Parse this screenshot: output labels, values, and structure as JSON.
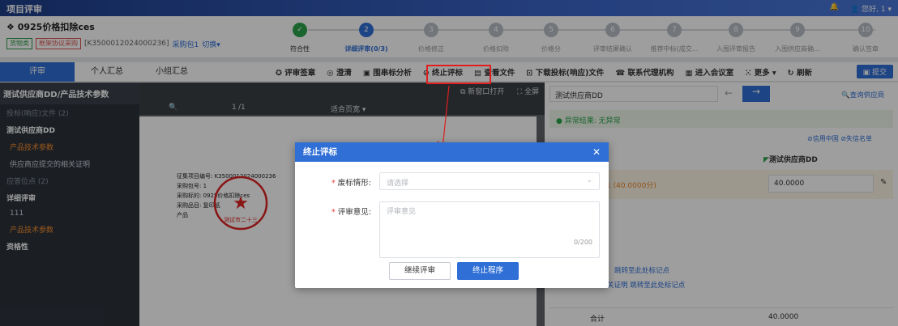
{
  "app": {
    "title": "项目评审",
    "greeting": "您好, 1"
  },
  "project": {
    "name": "0925价格扣除ces",
    "tag1": "货物类",
    "tag2": "框架协议采购",
    "code": "[K3500012024000236]",
    "package": "采购包1",
    "switch": "切换"
  },
  "steps": [
    {
      "num": "✓",
      "label": "符合性",
      "state": "done"
    },
    {
      "num": "2",
      "label": "详细评审(0/3)",
      "state": "current"
    },
    {
      "num": "3",
      "label": "价格修正",
      "state": "todo"
    },
    {
      "num": "4",
      "label": "价格扣除",
      "state": "todo"
    },
    {
      "num": "5",
      "label": "价格分",
      "state": "todo"
    },
    {
      "num": "6",
      "label": "评审结果确认",
      "state": "todo"
    },
    {
      "num": "7",
      "label": "推荐中标(成交...",
      "state": "todo"
    },
    {
      "num": "8",
      "label": "入围评审报告",
      "state": "todo"
    },
    {
      "num": "9",
      "label": "入围供应商确...",
      "state": "todo"
    },
    {
      "num": "10",
      "label": "确认签章",
      "state": "todo"
    }
  ],
  "tabs": [
    "评审",
    "个人汇总",
    "小组汇总"
  ],
  "tools": [
    "评审签章",
    "澄清",
    "围串标分析",
    "终止评标",
    "查看文件",
    "下载投标(响应)文件",
    "联系代理机构",
    "进入会议室",
    "更多",
    "刷新"
  ],
  "submit": "提交",
  "sidebar": {
    "header": "测试供应商DD/产品技术参数",
    "items": [
      {
        "label": "投标(响应)文件 (2)",
        "style": "muted"
      },
      {
        "label": "测试供应商DD",
        "style": "bold"
      },
      {
        "label": "产品技术参数",
        "style": "active"
      },
      {
        "label": "供应商应提交的相关证明",
        "style": "sub"
      },
      {
        "label": "应答位点 (2)",
        "style": "muted"
      },
      {
        "label": "详细评审",
        "style": "bold"
      },
      {
        "label": "111",
        "style": "sub"
      },
      {
        "label": "产品技术参数",
        "style": "active"
      },
      {
        "label": "资格性",
        "style": "bold"
      }
    ]
  },
  "doc": {
    "page_num": "1",
    "page_total": "/1",
    "zoom": "适合页宽",
    "open_new": "新窗口打开",
    "fullscreen": "全屏",
    "lines": [
      "征集项目编号: K3500012024000236",
      "采购包号: 1",
      "采购标的: 0925价格扣除ces",
      "采购品目: 复印纸",
      "产品"
    ],
    "seal": "测试市二十三"
  },
  "right": {
    "supplier": "测试供应商DD",
    "abnormal": "异常结果: 无异常",
    "credit": "信用中国",
    "blacklist": "失信名单",
    "supplier_col": "测试供应商DD",
    "score_label": "1  (40.0000分)",
    "score": "40.0000",
    "link1": "跳转至此处标记点",
    "link2": "的相关证明  跳转至此处标记点",
    "total_label": "合计",
    "total": "40.0000",
    "query": "查询供应商"
  },
  "modal": {
    "title": "终止评标",
    "f1_label": "废标情形:",
    "f1_placeholder": "请选择",
    "f2_label": "评审意见:",
    "f2_placeholder": "评审意见",
    "counter": "0/200",
    "btn_continue": "继续评审",
    "btn_stop": "终止程序"
  }
}
